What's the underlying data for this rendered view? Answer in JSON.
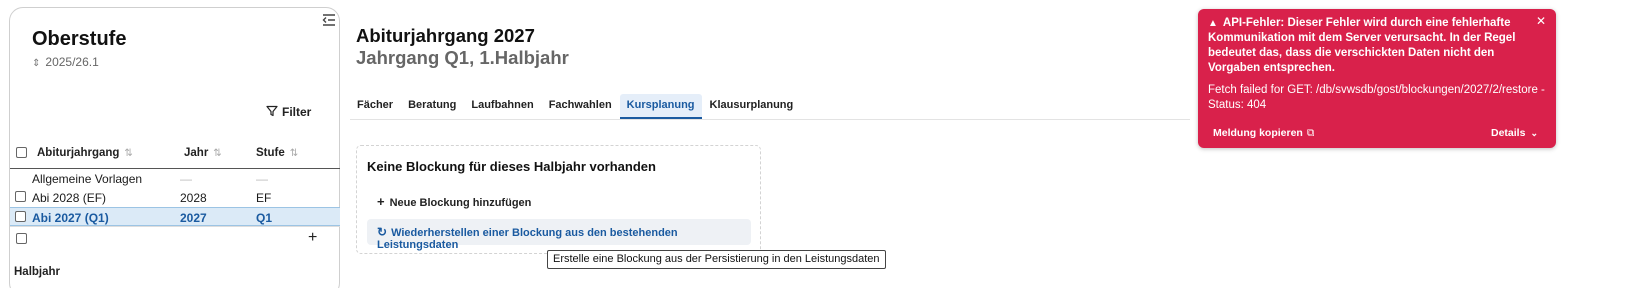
{
  "sidebar": {
    "title": "Oberstufe",
    "school_year": "2025/26.1",
    "filter_label": "Filter",
    "columns": [
      "Abiturjahrgang",
      "Jahr",
      "Stufe"
    ],
    "rows": [
      {
        "name": "Allgemeine Vorlagen",
        "jahr": "—",
        "stufe": "—"
      },
      {
        "name": "Abi 2028 (EF)",
        "jahr": "2028",
        "stufe": "EF"
      },
      {
        "name": "Abi 2027 (Q1)",
        "jahr": "2027",
        "stufe": "Q1"
      }
    ],
    "section_label": "Halbjahr"
  },
  "main": {
    "title": "Abiturjahrgang 2027",
    "subtitle": "Jahrgang Q1, 1.Halbjahr",
    "tabs": [
      "Fächer",
      "Beratung",
      "Laufbahnen",
      "Fachwahlen",
      "Kursplanung",
      "Klausurplanung"
    ],
    "active_tab": "Kursplanung"
  },
  "card": {
    "title": "Keine Blockung für dieses Halbjahr vorhanden",
    "new_label": "Neue Blockung hinzufügen",
    "restore_label": "Wiederherstellen einer Blockung aus den bestehenden Leistungsdaten"
  },
  "tooltip": "Erstelle eine Blockung aus der Persistierung in den Leistungsdaten",
  "toast": {
    "message": "API-Fehler: Dieser Fehler wird durch eine fehlerhafte Kommunikation mit dem Server verursacht. In der Regel bedeutet das, dass die verschickten Daten nicht den Vorgaben entsprechen.",
    "detail": "Fetch failed for GET: /db/svwsdb/gost/blockungen/2027/2/restore - Status: 404",
    "copy_label": "Meldung kopieren",
    "details_label": "Details",
    "color": "#d9214b"
  },
  "colors": {
    "accent": "#1a5aa0",
    "selected_bg": "#dbeaf7"
  }
}
